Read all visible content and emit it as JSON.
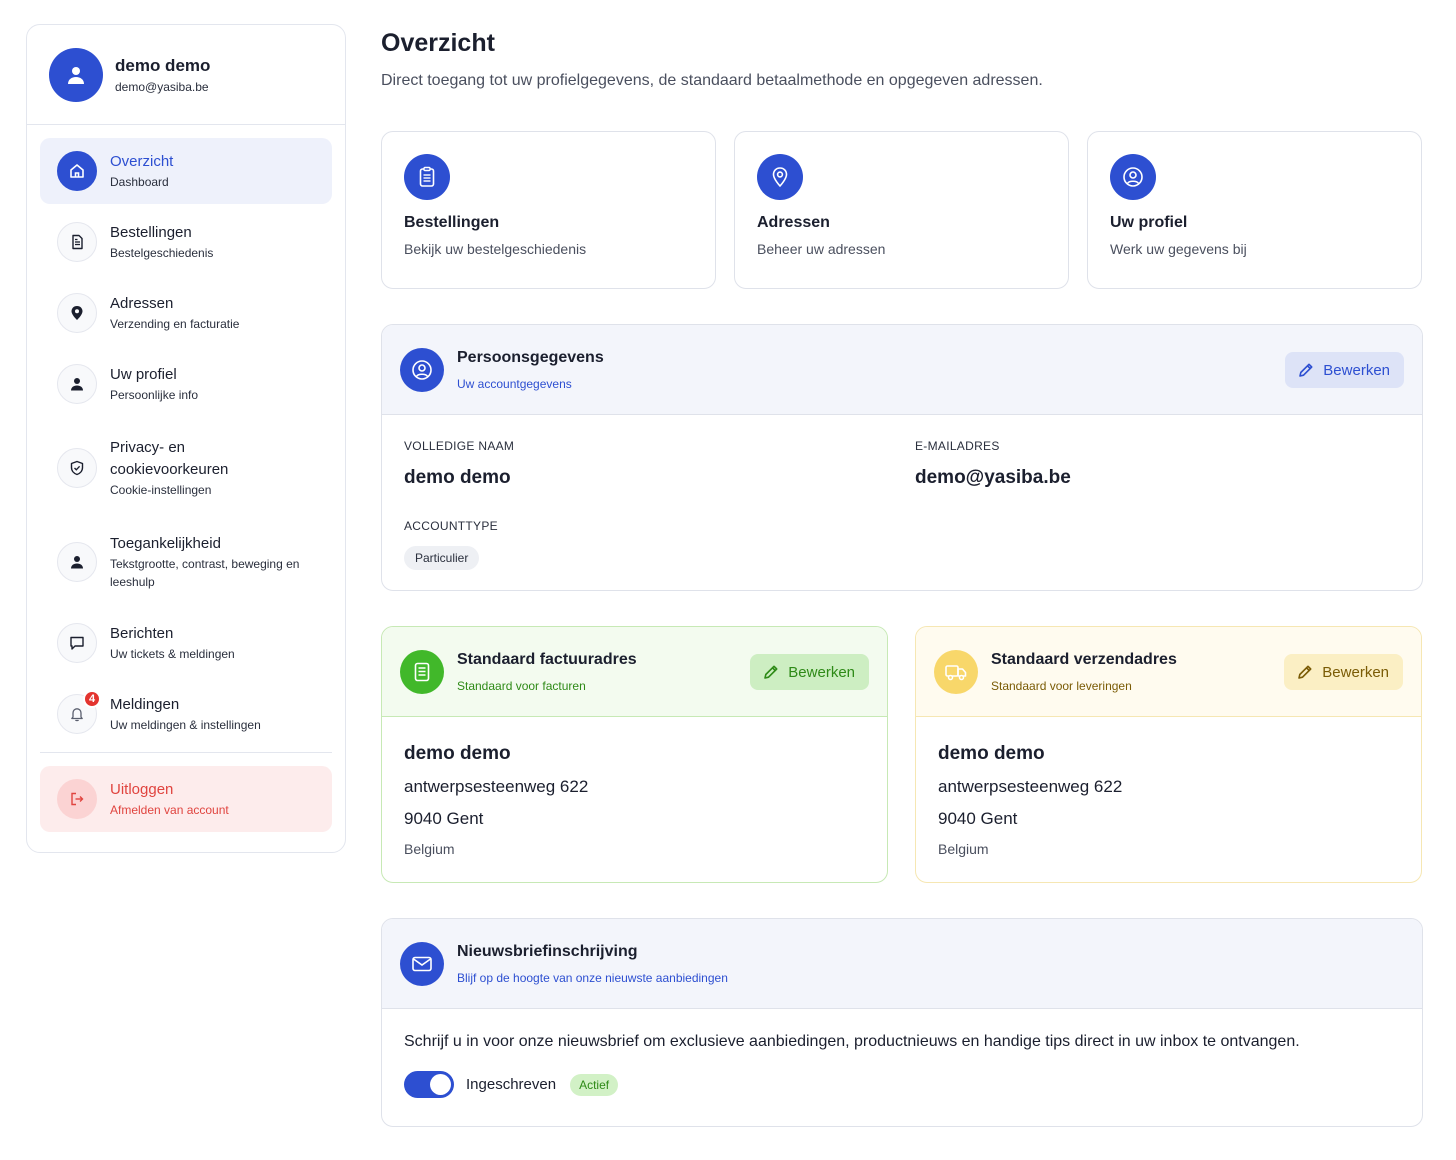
{
  "user": {
    "name": "demo demo",
    "email": "demo@yasiba.be"
  },
  "sidebar": {
    "items": [
      {
        "title": "Overzicht",
        "sub": "Dashboard",
        "icon": "home-icon"
      },
      {
        "title": "Bestellingen",
        "sub": "Bestelgeschiedenis",
        "icon": "document-icon"
      },
      {
        "title": "Adressen",
        "sub": "Verzending en facturatie",
        "icon": "map-pin-icon"
      },
      {
        "title": "Uw profiel",
        "sub": "Persoonlijke info",
        "icon": "user-icon"
      },
      {
        "title": "Privacy- en cookievoorkeuren",
        "sub": "Cookie-instellingen",
        "icon": "shield-icon"
      },
      {
        "title": "Toegankelijkheid",
        "sub": "Tekstgrootte, contrast, beweging en leeshulp",
        "icon": "user-icon"
      },
      {
        "title": "Berichten",
        "sub": "Uw tickets & meldingen",
        "icon": "chat-icon"
      },
      {
        "title": "Meldingen",
        "sub": "Uw meldingen & instellingen",
        "icon": "bell-icon",
        "badge": "4"
      }
    ],
    "logout": {
      "title": "Uitloggen",
      "sub": "Afmelden van account",
      "icon": "logout-icon"
    }
  },
  "page": {
    "title": "Overzicht",
    "subtitle": "Direct toegang tot uw profielgegevens, de standaard betaalmethode en opgegeven adressen."
  },
  "quick_cards": [
    {
      "title": "Bestellingen",
      "sub": "Bekijk uw bestelgeschiedenis",
      "icon": "clipboard-icon"
    },
    {
      "title": "Adressen",
      "sub": "Beheer uw adressen",
      "icon": "map-pin-icon"
    },
    {
      "title": "Uw profiel",
      "sub": "Werk uw gegevens bij",
      "icon": "user-circle-icon"
    }
  ],
  "personal": {
    "title": "Persoonsgegevens",
    "sub": "Uw accountgegevens",
    "edit_label": "Bewerken",
    "full_name_label": "VOLLEDIGE NAAM",
    "full_name": "demo demo",
    "email_label": "E-MAILADRES",
    "email": "demo@yasiba.be",
    "account_type_label": "ACCOUNTTYPE",
    "account_type": "Particulier"
  },
  "billing": {
    "title": "Standaard factuuradres",
    "sub": "Standaard voor facturen",
    "edit_label": "Bewerken",
    "name": "demo demo",
    "street": "antwerpsesteenweg 622",
    "city": "9040 Gent",
    "country": "Belgium"
  },
  "shipping": {
    "title": "Standaard verzendadres",
    "sub": "Standaard voor leveringen",
    "edit_label": "Bewerken",
    "name": "demo demo",
    "street": "antwerpsesteenweg 622",
    "city": "9040 Gent",
    "country": "Belgium"
  },
  "newsletter": {
    "title": "Nieuwsbriefinschrijving",
    "sub": "Blijf op de hoogte van onze nieuwste aanbiedingen",
    "text": "Schrijf u in voor onze nieuwsbrief om exclusieve aanbiedingen, productnieuws en handige tips direct in uw inbox te ontvangen.",
    "toggle_label": "Ingeschreven",
    "status": "Actief",
    "subscribed": true
  },
  "colors": {
    "primary": "#2d4fd1",
    "green": "#41b82a",
    "yellow": "#f8d76a",
    "danger": "#e0443f"
  }
}
